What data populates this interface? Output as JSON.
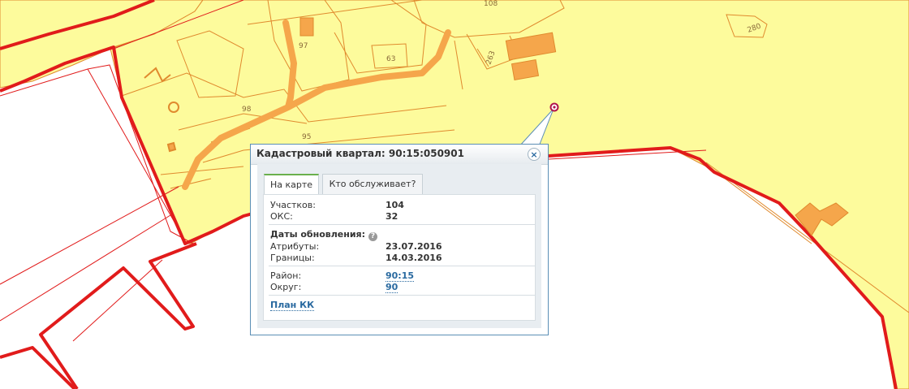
{
  "map": {
    "colors": {
      "parcel_fill": "#fdfb9c",
      "parcel_stroke": "#e08a2e",
      "boundary": "#e11b1b",
      "building": "#f5a64b"
    },
    "parcel_labels": [
      "108",
      "280",
      "97",
      "63",
      "263",
      "98",
      "95"
    ],
    "marker_icon": "location-pin-icon"
  },
  "popup": {
    "title": "Кадастровый квартал: 90:15:050901",
    "close_icon": "close-icon",
    "tabs": [
      {
        "label": "На карте",
        "active": true
      },
      {
        "label": "Кто обслуживает?",
        "active": false
      }
    ],
    "counts": [
      {
        "label": "Участков:",
        "value": "104"
      },
      {
        "label": "ОКС:",
        "value": "32"
      }
    ],
    "updates": {
      "title": "Даты обновления:",
      "help_icon": "help-icon",
      "help_glyph": "?",
      "items": [
        {
          "label": "Атрибуты:",
          "value": "23.07.2016"
        },
        {
          "label": "Границы:",
          "value": "14.03.2016"
        }
      ]
    },
    "location": [
      {
        "label": "Район:",
        "value": "90:15"
      },
      {
        "label": "Округ:",
        "value": "90"
      }
    ],
    "plan_link": "План КК"
  }
}
